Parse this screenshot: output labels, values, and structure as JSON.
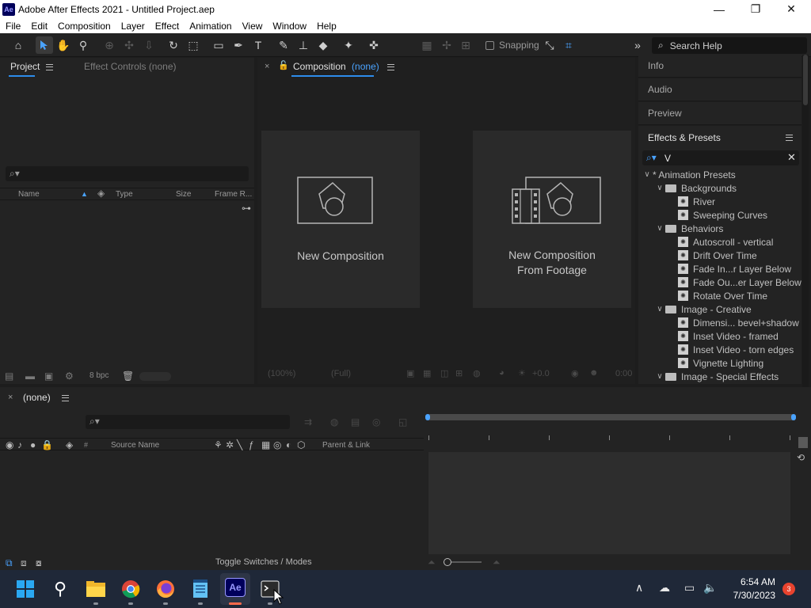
{
  "window": {
    "app_icon_label": "Ae",
    "title": "Adobe After Effects 2021 - Untitled Project.aep",
    "minimize_glyph": "—",
    "maximize_glyph": "❐",
    "close_glyph": "✕"
  },
  "menu": [
    "File",
    "Edit",
    "Composition",
    "Layer",
    "Effect",
    "Animation",
    "View",
    "Window",
    "Help"
  ],
  "toolbar": {
    "snapping_label": "Snapping",
    "search_help_placeholder": "Search Help"
  },
  "project_panel": {
    "tab_project": "Project",
    "tab_effect_controls": "Effect Controls (none)",
    "columns": [
      "Name",
      "Type",
      "Size",
      "Frame R..."
    ],
    "bpc_label": "8 bpc"
  },
  "composition_panel": {
    "tab_label": "Composition",
    "tab_value": "(none)",
    "new_composition_label": "New Composition",
    "new_from_footage_line1": "New Composition",
    "new_from_footage_line2": "From Footage",
    "footer_zoom": "(100%)",
    "footer_res": "(Full)",
    "footer_exposure": "+0.0",
    "footer_time": "0:00"
  },
  "right_panels": {
    "info": "Info",
    "audio": "Audio",
    "preview": "Preview",
    "effects_title": "Effects & Presets",
    "search_value": "V"
  },
  "effects_tree": [
    {
      "label": "* Animation Presets",
      "level": 0,
      "kind": "root"
    },
    {
      "label": "Backgrounds",
      "level": 1,
      "kind": "folder"
    },
    {
      "label": "River",
      "level": 2,
      "kind": "preset"
    },
    {
      "label": "Sweeping Curves",
      "level": 2,
      "kind": "preset"
    },
    {
      "label": "Behaviors",
      "level": 1,
      "kind": "folder"
    },
    {
      "label": "Autoscroll - vertical",
      "level": 2,
      "kind": "preset"
    },
    {
      "label": "Drift Over Time",
      "level": 2,
      "kind": "preset"
    },
    {
      "label": "Fade In...r Layer Below",
      "level": 2,
      "kind": "preset"
    },
    {
      "label": "Fade Ou...er Layer Below",
      "level": 2,
      "kind": "preset"
    },
    {
      "label": "Rotate Over Time",
      "level": 2,
      "kind": "preset"
    },
    {
      "label": "Image - Creative",
      "level": 1,
      "kind": "folder"
    },
    {
      "label": "Dimensi... bevel+shadow",
      "level": 2,
      "kind": "preset"
    },
    {
      "label": "Inset Video - framed",
      "level": 2,
      "kind": "preset"
    },
    {
      "label": "Inset Video - torn edges",
      "level": 2,
      "kind": "preset"
    },
    {
      "label": "Vignette Lighting",
      "level": 2,
      "kind": "preset"
    },
    {
      "label": "Image - Special Effects",
      "level": 1,
      "kind": "folder"
    }
  ],
  "timeline": {
    "tab_label": "(none)",
    "col_hash": "#",
    "col_source_name": "Source Name",
    "col_parent_link": "Parent & Link",
    "toggle_switches": "Toggle Switches / Modes"
  },
  "taskbar": {
    "time": "6:54 AM",
    "date": "7/30/2023",
    "notification_count": "3"
  }
}
